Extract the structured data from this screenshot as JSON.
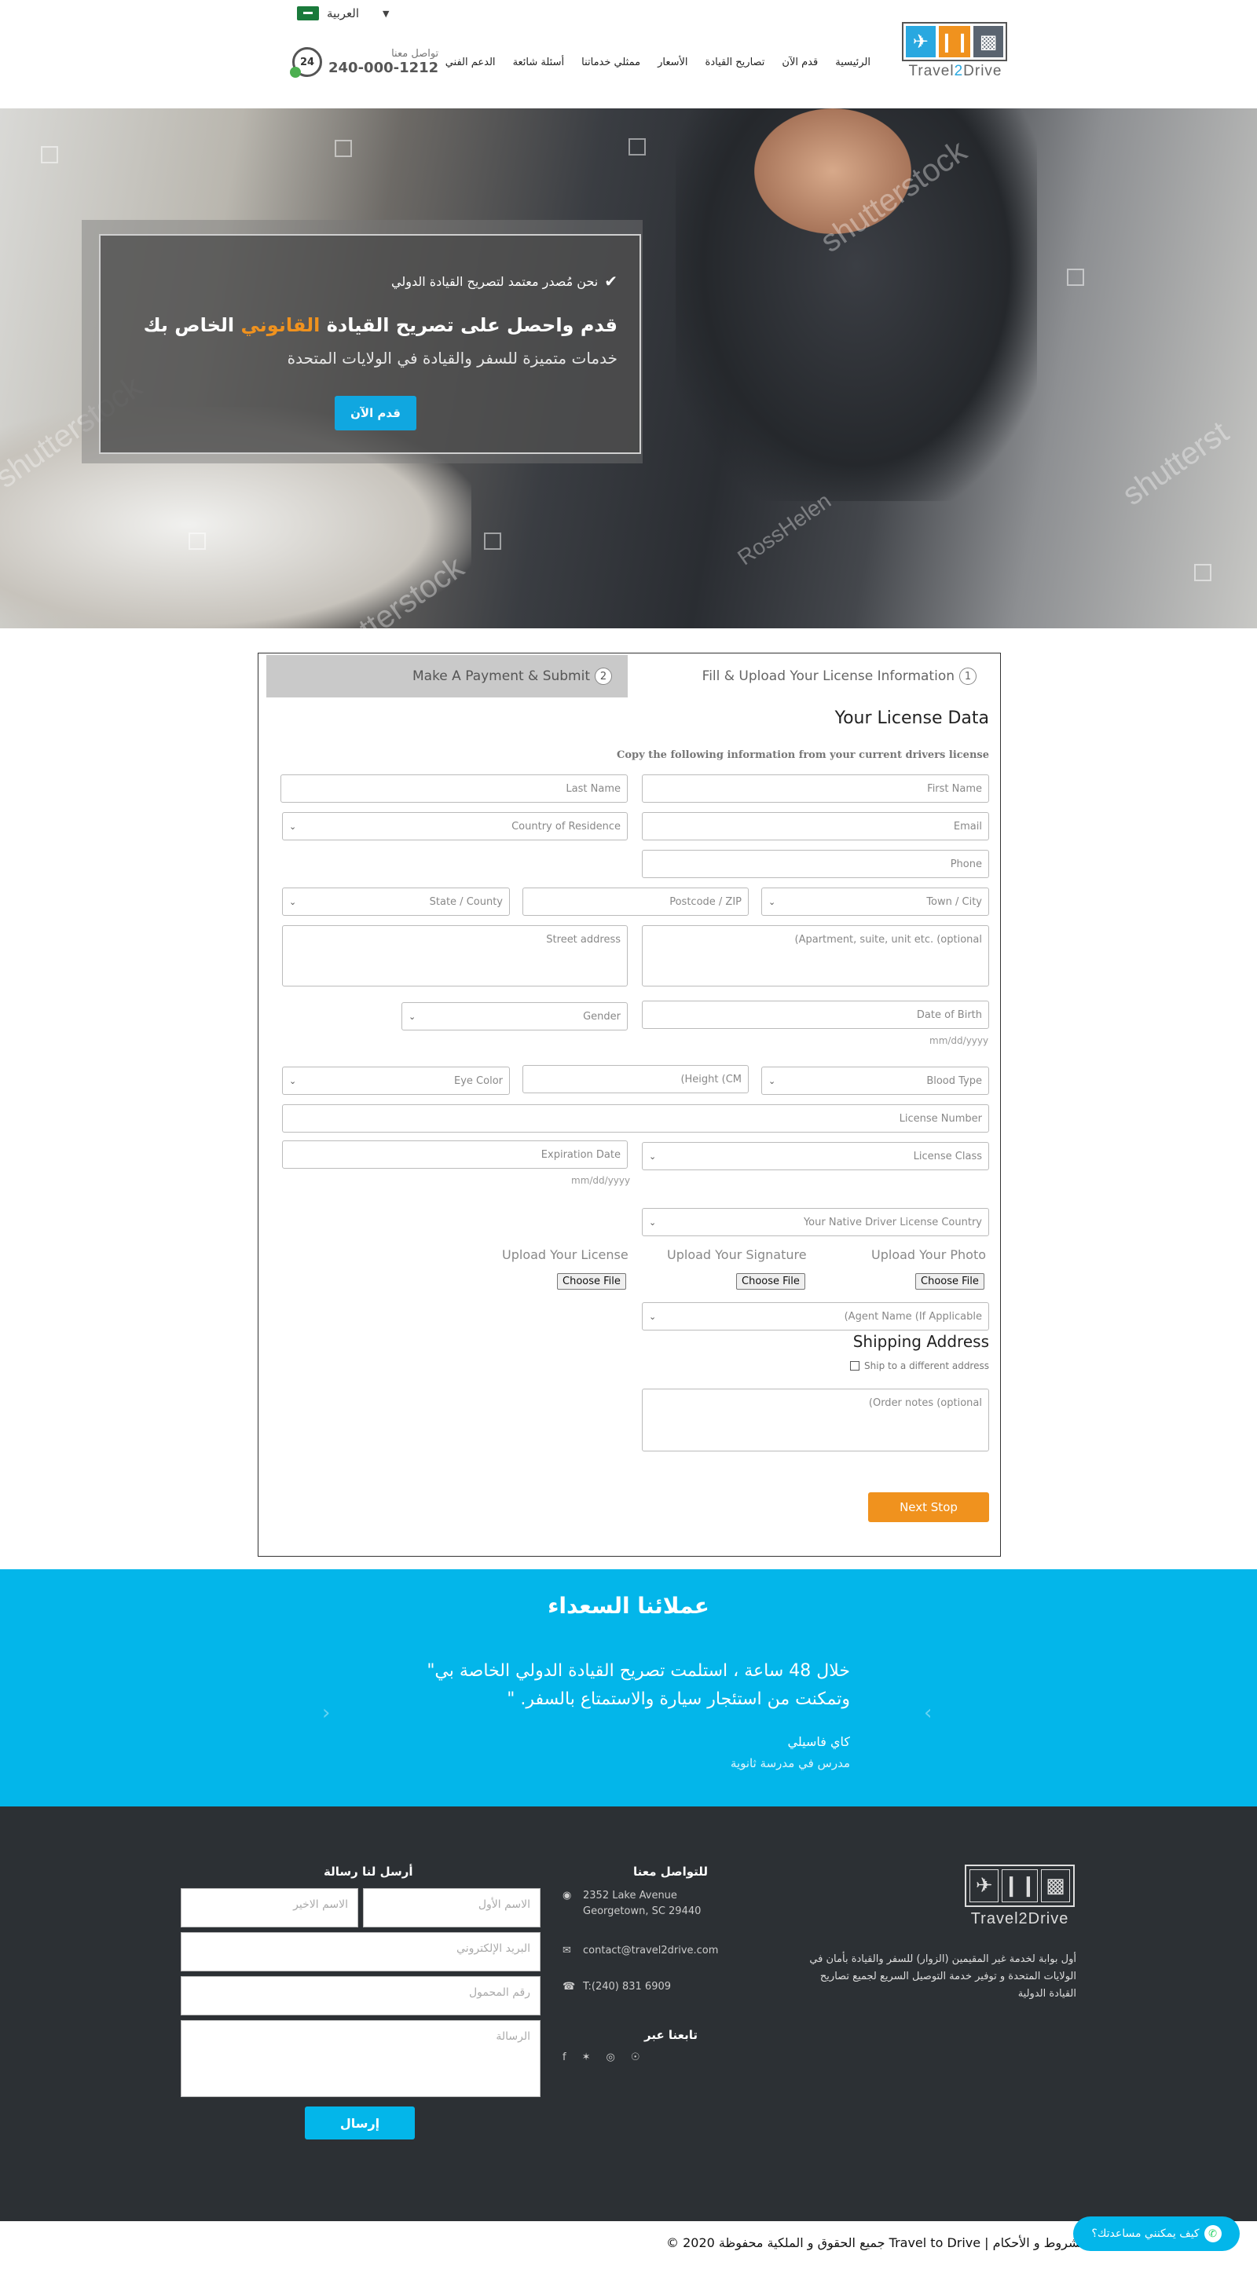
{
  "header": {
    "language": "العربية",
    "nav": [
      "الرئيسية",
      "قدم الآن",
      "تصاريح القيادة",
      "الأسعار",
      "ممثلي خدماتنا",
      "أسئلة شائعة",
      "الدعم الفني"
    ],
    "contact_label": "تواصل معنا",
    "contact_phone": "240-000-1212",
    "phone_badge": "24",
    "logo_prefix": "Travel",
    "logo_mid": "2",
    "logo_suffix": "Drive"
  },
  "hero": {
    "line1": "نحن مُصدر معتمد لتصريح القيادة الدولي",
    "line2_a": "قدم واحصل على تصريح القيادة ",
    "line2_hl": "القانوني",
    "line2_b": " الخاص بك",
    "line3": "خدمات متميزة للسفر والقيادة في الولايات المتحدة",
    "cta": "قدم الآن",
    "watermarks": [
      "shutterstock",
      "shutterst",
      "shutterstock",
      "RossHelen",
      "shutterstock"
    ]
  },
  "form": {
    "tab1_num": "1",
    "tab1_label": "Fill & Upload Your License Information",
    "tab2_num": "2",
    "tab2_label": "Make A Payment & Submit",
    "title": "Your License Data",
    "subtitle": "Copy the following information from your current drivers license",
    "first_name": "First Name",
    "last_name": "Last Name",
    "email": "Email",
    "country": "Country of Residence",
    "phone": "Phone",
    "town": "Town / City",
    "postcode": "Postcode / ZIP",
    "state": "State / County",
    "apartment": "(Apartment, suite, unit etc. (optional",
    "street": "Street address",
    "dob": "Date of Birth",
    "dob_hint": "mm/dd/yyyy",
    "gender": "Gender",
    "blood": "Blood Type",
    "height": "(Height (CM",
    "eye": "Eye Color",
    "license_number": "License Number",
    "license_class": "License Class",
    "expiration": "Expiration Date",
    "exp_hint": "mm/dd/yyyy",
    "native_country": "Your Native Driver License Country",
    "upload_photo": "Upload Your Photo",
    "upload_signature": "Upload Your Signature",
    "upload_license": "Upload Your License",
    "choose_file": "Choose File",
    "agent": "(Agent Name (If Applicable",
    "shipping_title": "Shipping Address",
    "ship_different": "Ship to a different address",
    "order_notes": "(Order notes (optional",
    "next": "Next Stop"
  },
  "testimonials": {
    "title": "عملائنا السعداء",
    "quote": "خلال 48 ساعة ، استلمت تصريح القيادة الدولي الخاصة بي\" وتمكنت من استئجار سيارة والاستمتاع بالسفر. \"",
    "name": "كاي فاسيلي",
    "role": "مدرس في مدرسة ثانوية",
    "prev": "‹",
    "next": "›"
  },
  "footer": {
    "description": "أول بوابة لخدمة غير المقيمين (الزوار) للسفر والقيادة بأمان في الولايات المتحدة و توفير خدمة التوصيل السريع لجميع تصاريح القيادة الدولية",
    "contact_title": "للتواصل معنا",
    "address_line1": "2352 Lake Avenue",
    "address_line2": "Georgetown, SC 29440",
    "email": "contact@travel2drive.com",
    "phone": "T:(240) 831 6909",
    "follow_title": "تابعنا عبر",
    "message_title": "أرسل لنا رسالة",
    "first_name": "الاسم الأول",
    "last_name": "الاسم الاخير",
    "email_ph": "البريد الإلكتروني",
    "mobile_ph": "رقم المحمول",
    "message_ph": "الرسالة",
    "send": "إرسال",
    "copyright": "الشروط و الأحكام | Travel to Drive جميع الحقوق و الملكية محفوظة 2020 ©",
    "whatsapp": "كيف يمكنني مساعدتك؟"
  }
}
